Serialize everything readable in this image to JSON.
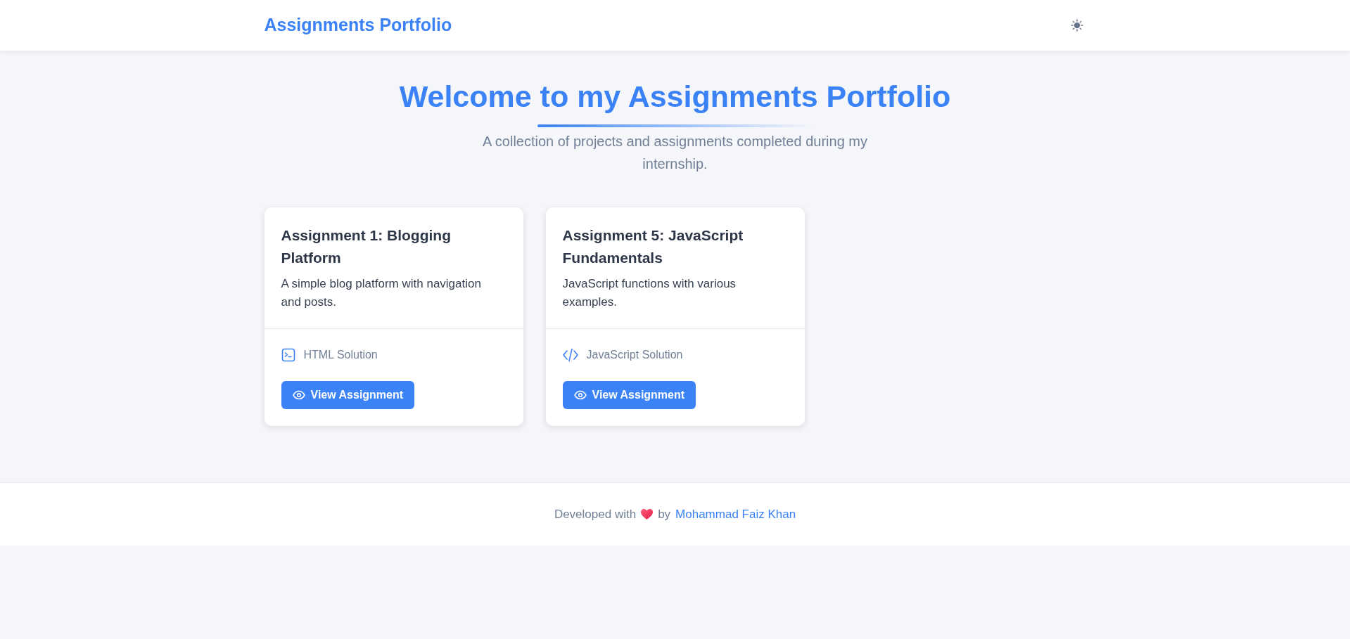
{
  "header": {
    "title": "Assignments Portfolio"
  },
  "hero": {
    "title": "Welcome to my Assignments Portfolio",
    "subtitle": "A collection of projects and assignments completed during my internship."
  },
  "cards": [
    {
      "title": "Assignment 1: Blogging Platform",
      "description": "A simple blog platform with navigation and posts.",
      "solution": {
        "kind": "terminal",
        "label": "HTML Solution"
      },
      "button": "View Assignment"
    },
    {
      "title": "Assignment 5: JavaScript Fundamentals",
      "description": "JavaScript functions with various examples.",
      "solution": {
        "kind": "code",
        "label": "JavaScript Solution"
      },
      "button": "View Assignment"
    }
  ],
  "footer": {
    "prefix": "Developed with",
    "middle": "by",
    "author": "Mohammad Faiz Khan"
  }
}
